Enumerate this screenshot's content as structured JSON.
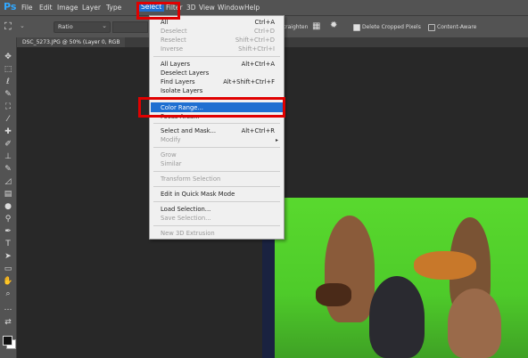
{
  "app": {
    "logo": "Ps"
  },
  "menubar": {
    "items": [
      "File",
      "Edit",
      "Image",
      "Layer",
      "Type",
      "Select",
      "Filter",
      "3D",
      "View",
      "Window",
      "Help"
    ],
    "active": "Select"
  },
  "options": {
    "ratio_label": "Ratio",
    "straighten_label": "Straighten",
    "delete_cropped_label": "Delete Cropped Pixels",
    "content_aware_label": "Content-Aware"
  },
  "document": {
    "tab_title": "DSC_5273.JPG @ 50% (Layer 0, RGB"
  },
  "select_menu": {
    "all": "All",
    "all_sc": "Ctrl+A",
    "deselect": "Deselect",
    "deselect_sc": "Ctrl+D",
    "reselect": "Reselect",
    "reselect_sc": "Shift+Ctrl+D",
    "inverse": "Inverse",
    "inverse_sc": "Shift+Ctrl+I",
    "all_layers": "All Layers",
    "all_layers_sc": "Alt+Ctrl+A",
    "deselect_layers": "Deselect Layers",
    "find_layers": "Find Layers",
    "find_layers_sc": "Alt+Shift+Ctrl+F",
    "isolate_layers": "Isolate Layers",
    "color_range": "Color Range...",
    "focus_area": "Focus Area...",
    "select_and_mask": "Select and Mask...",
    "select_and_mask_sc": "Alt+Ctrl+R",
    "modify": "Modify",
    "grow": "Grow",
    "similar": "Similar",
    "transform_selection": "Transform Selection",
    "quick_mask": "Edit in Quick Mask Mode",
    "load_selection": "Load Selection...",
    "save_selection": "Save Selection...",
    "new_3d_extrusion": "New 3D Extrusion"
  },
  "tools": [
    "move-icon",
    "marquee-icon",
    "lasso-icon",
    "quick-select-icon",
    "crop-icon",
    "eyedropper-icon",
    "healing-brush-icon",
    "brush-icon",
    "clone-stamp-icon",
    "history-brush-icon",
    "eraser-icon",
    "gradient-icon",
    "blur-icon",
    "dodge-icon",
    "pen-icon",
    "type-icon",
    "path-select-icon",
    "rectangle-icon",
    "hand-icon",
    "zoom-icon",
    "more-icon"
  ],
  "colors": {
    "highlight": "#1f6fd1",
    "annotation": "#e00000",
    "green_screen": "#4ecb2a"
  }
}
